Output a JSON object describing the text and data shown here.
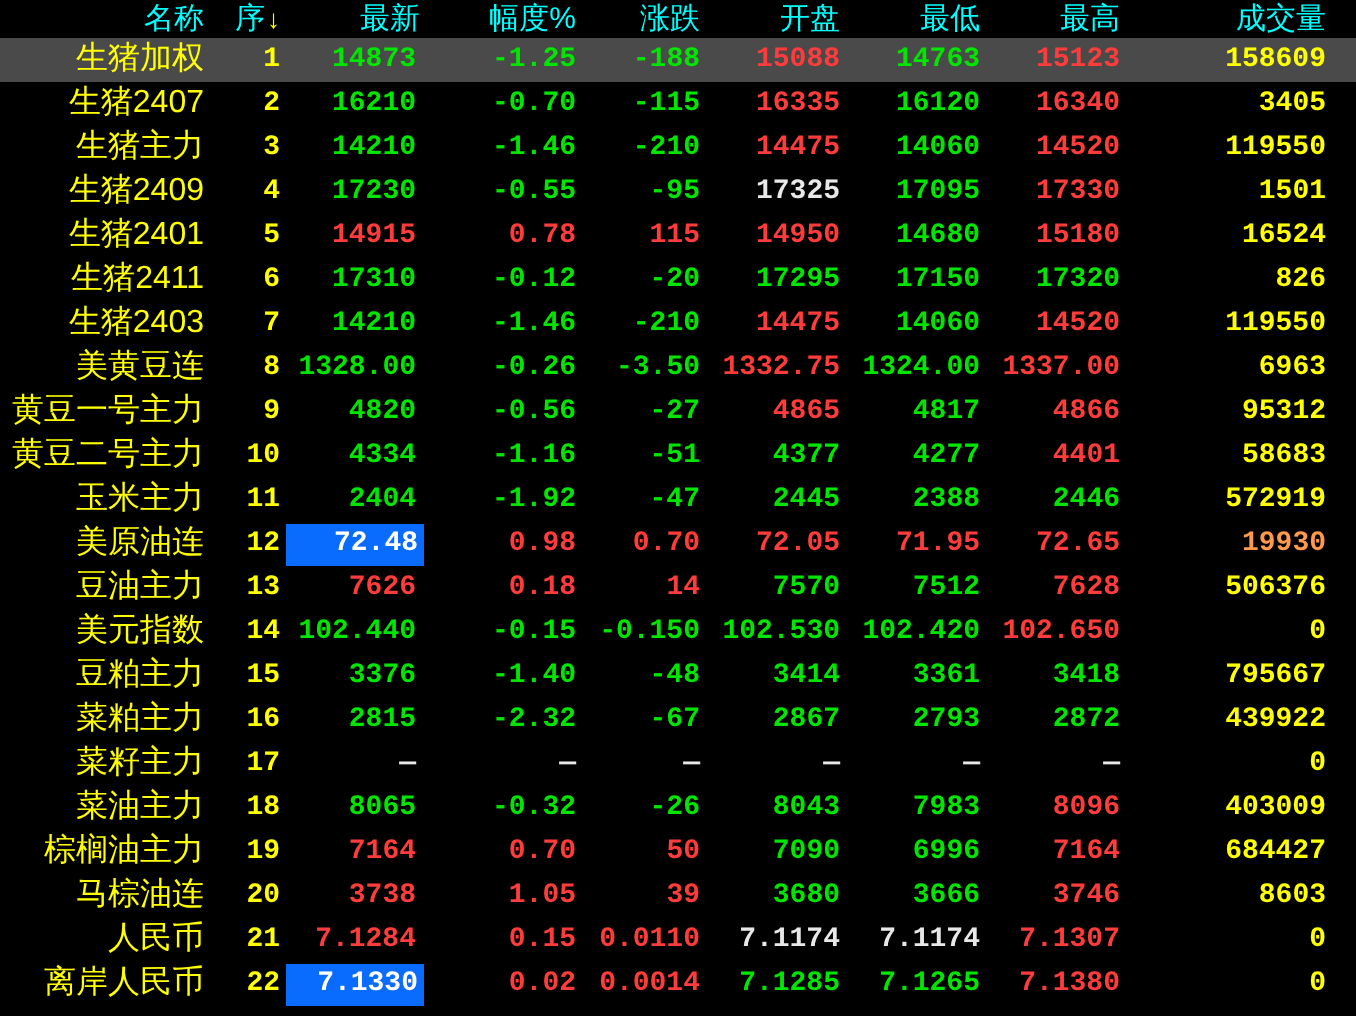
{
  "table": {
    "columns": [
      {
        "label": "名称"
      },
      {
        "label": "序",
        "sort_marker": "↓"
      },
      {
        "label": "最新"
      },
      {
        "label": "幅度%"
      },
      {
        "label": "涨跌"
      },
      {
        "label": "开盘"
      },
      {
        "label": "最低"
      },
      {
        "label": "最高"
      },
      {
        "label": "成交量"
      }
    ],
    "rows": [
      {
        "selected": true,
        "price_highlighted": false,
        "cells": [
          {
            "text": "生猪加权",
            "color": "#ffff00"
          },
          {
            "text": "1",
            "color": "#ffff00"
          },
          {
            "text": "14873",
            "color": "#00e600"
          },
          {
            "text": "-1.25",
            "color": "#00e600"
          },
          {
            "text": "-188",
            "color": "#00e600"
          },
          {
            "text": "15088",
            "color": "#ff3c3c"
          },
          {
            "text": "14763",
            "color": "#00e600"
          },
          {
            "text": "15123",
            "color": "#ff3c3c"
          },
          {
            "text": "158609",
            "color": "#ffff00"
          }
        ]
      },
      {
        "selected": false,
        "price_highlighted": false,
        "cells": [
          {
            "text": "生猪2407",
            "color": "#ffff00"
          },
          {
            "text": "2",
            "color": "#ffff00"
          },
          {
            "text": "16210",
            "color": "#00e600"
          },
          {
            "text": "-0.70",
            "color": "#00e600"
          },
          {
            "text": "-115",
            "color": "#00e600"
          },
          {
            "text": "16335",
            "color": "#ff3c3c"
          },
          {
            "text": "16120",
            "color": "#00e600"
          },
          {
            "text": "16340",
            "color": "#ff3c3c"
          },
          {
            "text": "3405",
            "color": "#ffff00"
          }
        ]
      },
      {
        "selected": false,
        "price_highlighted": false,
        "cells": [
          {
            "text": "生猪主力",
            "color": "#ffff00"
          },
          {
            "text": "3",
            "color": "#ffff00"
          },
          {
            "text": "14210",
            "color": "#00e600"
          },
          {
            "text": "-1.46",
            "color": "#00e600"
          },
          {
            "text": "-210",
            "color": "#00e600"
          },
          {
            "text": "14475",
            "color": "#ff3c3c"
          },
          {
            "text": "14060",
            "color": "#00e600"
          },
          {
            "text": "14520",
            "color": "#ff3c3c"
          },
          {
            "text": "119550",
            "color": "#ffff00"
          }
        ]
      },
      {
        "selected": false,
        "price_highlighted": false,
        "cells": [
          {
            "text": "生猪2409",
            "color": "#ffff00"
          },
          {
            "text": "4",
            "color": "#ffff00"
          },
          {
            "text": "17230",
            "color": "#00e600"
          },
          {
            "text": "-0.55",
            "color": "#00e600"
          },
          {
            "text": "-95",
            "color": "#00e600"
          },
          {
            "text": "17325",
            "color": "#e8e8e8"
          },
          {
            "text": "17095",
            "color": "#00e600"
          },
          {
            "text": "17330",
            "color": "#ff3c3c"
          },
          {
            "text": "1501",
            "color": "#ffff00"
          }
        ]
      },
      {
        "selected": false,
        "price_highlighted": false,
        "cells": [
          {
            "text": "生猪2401",
            "color": "#ffff00"
          },
          {
            "text": "5",
            "color": "#ffff00"
          },
          {
            "text": "14915",
            "color": "#ff3c3c"
          },
          {
            "text": "0.78",
            "color": "#ff3c3c"
          },
          {
            "text": "115",
            "color": "#ff3c3c"
          },
          {
            "text": "14950",
            "color": "#ff3c3c"
          },
          {
            "text": "14680",
            "color": "#00e600"
          },
          {
            "text": "15180",
            "color": "#ff3c3c"
          },
          {
            "text": "16524",
            "color": "#ffff00"
          }
        ]
      },
      {
        "selected": false,
        "price_highlighted": false,
        "cells": [
          {
            "text": "生猪2411",
            "color": "#ffff00"
          },
          {
            "text": "6",
            "color": "#ffff00"
          },
          {
            "text": "17310",
            "color": "#00e600"
          },
          {
            "text": "-0.12",
            "color": "#00e600"
          },
          {
            "text": "-20",
            "color": "#00e600"
          },
          {
            "text": "17295",
            "color": "#00e600"
          },
          {
            "text": "17150",
            "color": "#00e600"
          },
          {
            "text": "17320",
            "color": "#00e600"
          },
          {
            "text": "826",
            "color": "#ffff00"
          }
        ]
      },
      {
        "selected": false,
        "price_highlighted": false,
        "cells": [
          {
            "text": "生猪2403",
            "color": "#ffff00"
          },
          {
            "text": "7",
            "color": "#ffff00"
          },
          {
            "text": "14210",
            "color": "#00e600"
          },
          {
            "text": "-1.46",
            "color": "#00e600"
          },
          {
            "text": "-210",
            "color": "#00e600"
          },
          {
            "text": "14475",
            "color": "#ff3c3c"
          },
          {
            "text": "14060",
            "color": "#00e600"
          },
          {
            "text": "14520",
            "color": "#ff3c3c"
          },
          {
            "text": "119550",
            "color": "#ffff00"
          }
        ]
      },
      {
        "selected": false,
        "price_highlighted": false,
        "cells": [
          {
            "text": "美黄豆连",
            "color": "#ffff00"
          },
          {
            "text": "8",
            "color": "#ffff00"
          },
          {
            "text": "1328.00",
            "color": "#00e600"
          },
          {
            "text": "-0.26",
            "color": "#00e600"
          },
          {
            "text": "-3.50",
            "color": "#00e600"
          },
          {
            "text": "1332.75",
            "color": "#ff3c3c"
          },
          {
            "text": "1324.00",
            "color": "#00e600"
          },
          {
            "text": "1337.00",
            "color": "#ff3c3c"
          },
          {
            "text": "6963",
            "color": "#ffff00"
          }
        ]
      },
      {
        "selected": false,
        "price_highlighted": false,
        "cells": [
          {
            "text": "黄豆一号主力",
            "color": "#ffff00"
          },
          {
            "text": "9",
            "color": "#ffff00"
          },
          {
            "text": "4820",
            "color": "#00e600"
          },
          {
            "text": "-0.56",
            "color": "#00e600"
          },
          {
            "text": "-27",
            "color": "#00e600"
          },
          {
            "text": "4865",
            "color": "#ff3c3c"
          },
          {
            "text": "4817",
            "color": "#00e600"
          },
          {
            "text": "4866",
            "color": "#ff3c3c"
          },
          {
            "text": "95312",
            "color": "#ffff00"
          }
        ]
      },
      {
        "selected": false,
        "price_highlighted": false,
        "cells": [
          {
            "text": "黄豆二号主力",
            "color": "#ffff00"
          },
          {
            "text": "10",
            "color": "#ffff00"
          },
          {
            "text": "4334",
            "color": "#00e600"
          },
          {
            "text": "-1.16",
            "color": "#00e600"
          },
          {
            "text": "-51",
            "color": "#00e600"
          },
          {
            "text": "4377",
            "color": "#00e600"
          },
          {
            "text": "4277",
            "color": "#00e600"
          },
          {
            "text": "4401",
            "color": "#ff3c3c"
          },
          {
            "text": "58683",
            "color": "#ffff00"
          }
        ]
      },
      {
        "selected": false,
        "price_highlighted": false,
        "cells": [
          {
            "text": "玉米主力",
            "color": "#ffff00"
          },
          {
            "text": "11",
            "color": "#ffff00"
          },
          {
            "text": "2404",
            "color": "#00e600"
          },
          {
            "text": "-1.92",
            "color": "#00e600"
          },
          {
            "text": "-47",
            "color": "#00e600"
          },
          {
            "text": "2445",
            "color": "#00e600"
          },
          {
            "text": "2388",
            "color": "#00e600"
          },
          {
            "text": "2446",
            "color": "#00e600"
          },
          {
            "text": "572919",
            "color": "#ffff00"
          }
        ]
      },
      {
        "selected": false,
        "price_highlighted": true,
        "cells": [
          {
            "text": "美原油连",
            "color": "#ffff00"
          },
          {
            "text": "12",
            "color": "#ffff00"
          },
          {
            "text": "72.48",
            "color": "#ffffff"
          },
          {
            "text": "0.98",
            "color": "#ff3c3c"
          },
          {
            "text": "0.70",
            "color": "#ff3c3c"
          },
          {
            "text": "72.05",
            "color": "#ff3c3c"
          },
          {
            "text": "71.95",
            "color": "#ff3c3c"
          },
          {
            "text": "72.65",
            "color": "#ff3c3c"
          },
          {
            "text": "19930",
            "color": "#ff9a4a"
          }
        ]
      },
      {
        "selected": false,
        "price_highlighted": false,
        "cells": [
          {
            "text": "豆油主力",
            "color": "#ffff00"
          },
          {
            "text": "13",
            "color": "#ffff00"
          },
          {
            "text": "7626",
            "color": "#ff3c3c"
          },
          {
            "text": "0.18",
            "color": "#ff3c3c"
          },
          {
            "text": "14",
            "color": "#ff3c3c"
          },
          {
            "text": "7570",
            "color": "#00e600"
          },
          {
            "text": "7512",
            "color": "#00e600"
          },
          {
            "text": "7628",
            "color": "#ff3c3c"
          },
          {
            "text": "506376",
            "color": "#ffff00"
          }
        ]
      },
      {
        "selected": false,
        "price_highlighted": false,
        "cells": [
          {
            "text": "美元指数",
            "color": "#ffff00"
          },
          {
            "text": "14",
            "color": "#ffff00"
          },
          {
            "text": "102.440",
            "color": "#00e600"
          },
          {
            "text": "-0.15",
            "color": "#00e600"
          },
          {
            "text": "-0.150",
            "color": "#00e600"
          },
          {
            "text": "102.530",
            "color": "#00e600"
          },
          {
            "text": "102.420",
            "color": "#00e600"
          },
          {
            "text": "102.650",
            "color": "#ff3c3c"
          },
          {
            "text": "0",
            "color": "#ffff00"
          }
        ]
      },
      {
        "selected": false,
        "price_highlighted": false,
        "cells": [
          {
            "text": "豆粕主力",
            "color": "#ffff00"
          },
          {
            "text": "15",
            "color": "#ffff00"
          },
          {
            "text": "3376",
            "color": "#00e600"
          },
          {
            "text": "-1.40",
            "color": "#00e600"
          },
          {
            "text": "-48",
            "color": "#00e600"
          },
          {
            "text": "3414",
            "color": "#00e600"
          },
          {
            "text": "3361",
            "color": "#00e600"
          },
          {
            "text": "3418",
            "color": "#00e600"
          },
          {
            "text": "795667",
            "color": "#ffff00"
          }
        ]
      },
      {
        "selected": false,
        "price_highlighted": false,
        "cells": [
          {
            "text": "菜粕主力",
            "color": "#ffff00"
          },
          {
            "text": "16",
            "color": "#ffff00"
          },
          {
            "text": "2815",
            "color": "#00e600"
          },
          {
            "text": "-2.32",
            "color": "#00e600"
          },
          {
            "text": "-67",
            "color": "#00e600"
          },
          {
            "text": "2867",
            "color": "#00e600"
          },
          {
            "text": "2793",
            "color": "#00e600"
          },
          {
            "text": "2872",
            "color": "#00e600"
          },
          {
            "text": "439922",
            "color": "#ffff00"
          }
        ]
      },
      {
        "selected": false,
        "price_highlighted": false,
        "cells": [
          {
            "text": "菜籽主力",
            "color": "#ffff00"
          },
          {
            "text": "17",
            "color": "#ffff00"
          },
          {
            "text": "—",
            "color": "#e8e8e8"
          },
          {
            "text": "—",
            "color": "#e8e8e8"
          },
          {
            "text": "—",
            "color": "#e8e8e8"
          },
          {
            "text": "—",
            "color": "#e8e8e8"
          },
          {
            "text": "—",
            "color": "#e8e8e8"
          },
          {
            "text": "—",
            "color": "#e8e8e8"
          },
          {
            "text": "0",
            "color": "#ffff00"
          }
        ]
      },
      {
        "selected": false,
        "price_highlighted": false,
        "cells": [
          {
            "text": "菜油主力",
            "color": "#ffff00"
          },
          {
            "text": "18",
            "color": "#ffff00"
          },
          {
            "text": "8065",
            "color": "#00e600"
          },
          {
            "text": "-0.32",
            "color": "#00e600"
          },
          {
            "text": "-26",
            "color": "#00e600"
          },
          {
            "text": "8043",
            "color": "#00e600"
          },
          {
            "text": "7983",
            "color": "#00e600"
          },
          {
            "text": "8096",
            "color": "#ff3c3c"
          },
          {
            "text": "403009",
            "color": "#ffff00"
          }
        ]
      },
      {
        "selected": false,
        "price_highlighted": false,
        "cells": [
          {
            "text": "棕榈油主力",
            "color": "#ffff00"
          },
          {
            "text": "19",
            "color": "#ffff00"
          },
          {
            "text": "7164",
            "color": "#ff3c3c"
          },
          {
            "text": "0.70",
            "color": "#ff3c3c"
          },
          {
            "text": "50",
            "color": "#ff3c3c"
          },
          {
            "text": "7090",
            "color": "#00e600"
          },
          {
            "text": "6996",
            "color": "#00e600"
          },
          {
            "text": "7164",
            "color": "#ff3c3c"
          },
          {
            "text": "684427",
            "color": "#ffff00"
          }
        ]
      },
      {
        "selected": false,
        "price_highlighted": false,
        "cells": [
          {
            "text": "马棕油连",
            "color": "#ffff00"
          },
          {
            "text": "20",
            "color": "#ffff00"
          },
          {
            "text": "3738",
            "color": "#ff3c3c"
          },
          {
            "text": "1.05",
            "color": "#ff3c3c"
          },
          {
            "text": "39",
            "color": "#ff3c3c"
          },
          {
            "text": "3680",
            "color": "#00e600"
          },
          {
            "text": "3666",
            "color": "#00e600"
          },
          {
            "text": "3746",
            "color": "#ff3c3c"
          },
          {
            "text": "8603",
            "color": "#ffff00"
          }
        ]
      },
      {
        "selected": false,
        "price_highlighted": false,
        "cells": [
          {
            "text": "人民币",
            "color": "#ffff00"
          },
          {
            "text": "21",
            "color": "#ffff00"
          },
          {
            "text": "7.1284",
            "color": "#ff3c3c"
          },
          {
            "text": "0.15",
            "color": "#ff3c3c"
          },
          {
            "text": "0.0110",
            "color": "#ff3c3c"
          },
          {
            "text": "7.1174",
            "color": "#e8e8e8"
          },
          {
            "text": "7.1174",
            "color": "#e8e8e8"
          },
          {
            "text": "7.1307",
            "color": "#ff3c3c"
          },
          {
            "text": "0",
            "color": "#ffff00"
          }
        ]
      },
      {
        "selected": false,
        "price_highlighted": true,
        "cells": [
          {
            "text": "离岸人民币",
            "color": "#ffff00"
          },
          {
            "text": "22",
            "color": "#ffff00"
          },
          {
            "text": "7.1330",
            "color": "#ffffff"
          },
          {
            "text": "0.02",
            "color": "#ff3c3c"
          },
          {
            "text": "0.0014",
            "color": "#ff3c3c"
          },
          {
            "text": "7.1285",
            "color": "#00e600"
          },
          {
            "text": "7.1265",
            "color": "#00e600"
          },
          {
            "text": "7.1380",
            "color": "#ff3c3c"
          },
          {
            "text": "0",
            "color": "#ffff00"
          }
        ]
      }
    ]
  }
}
